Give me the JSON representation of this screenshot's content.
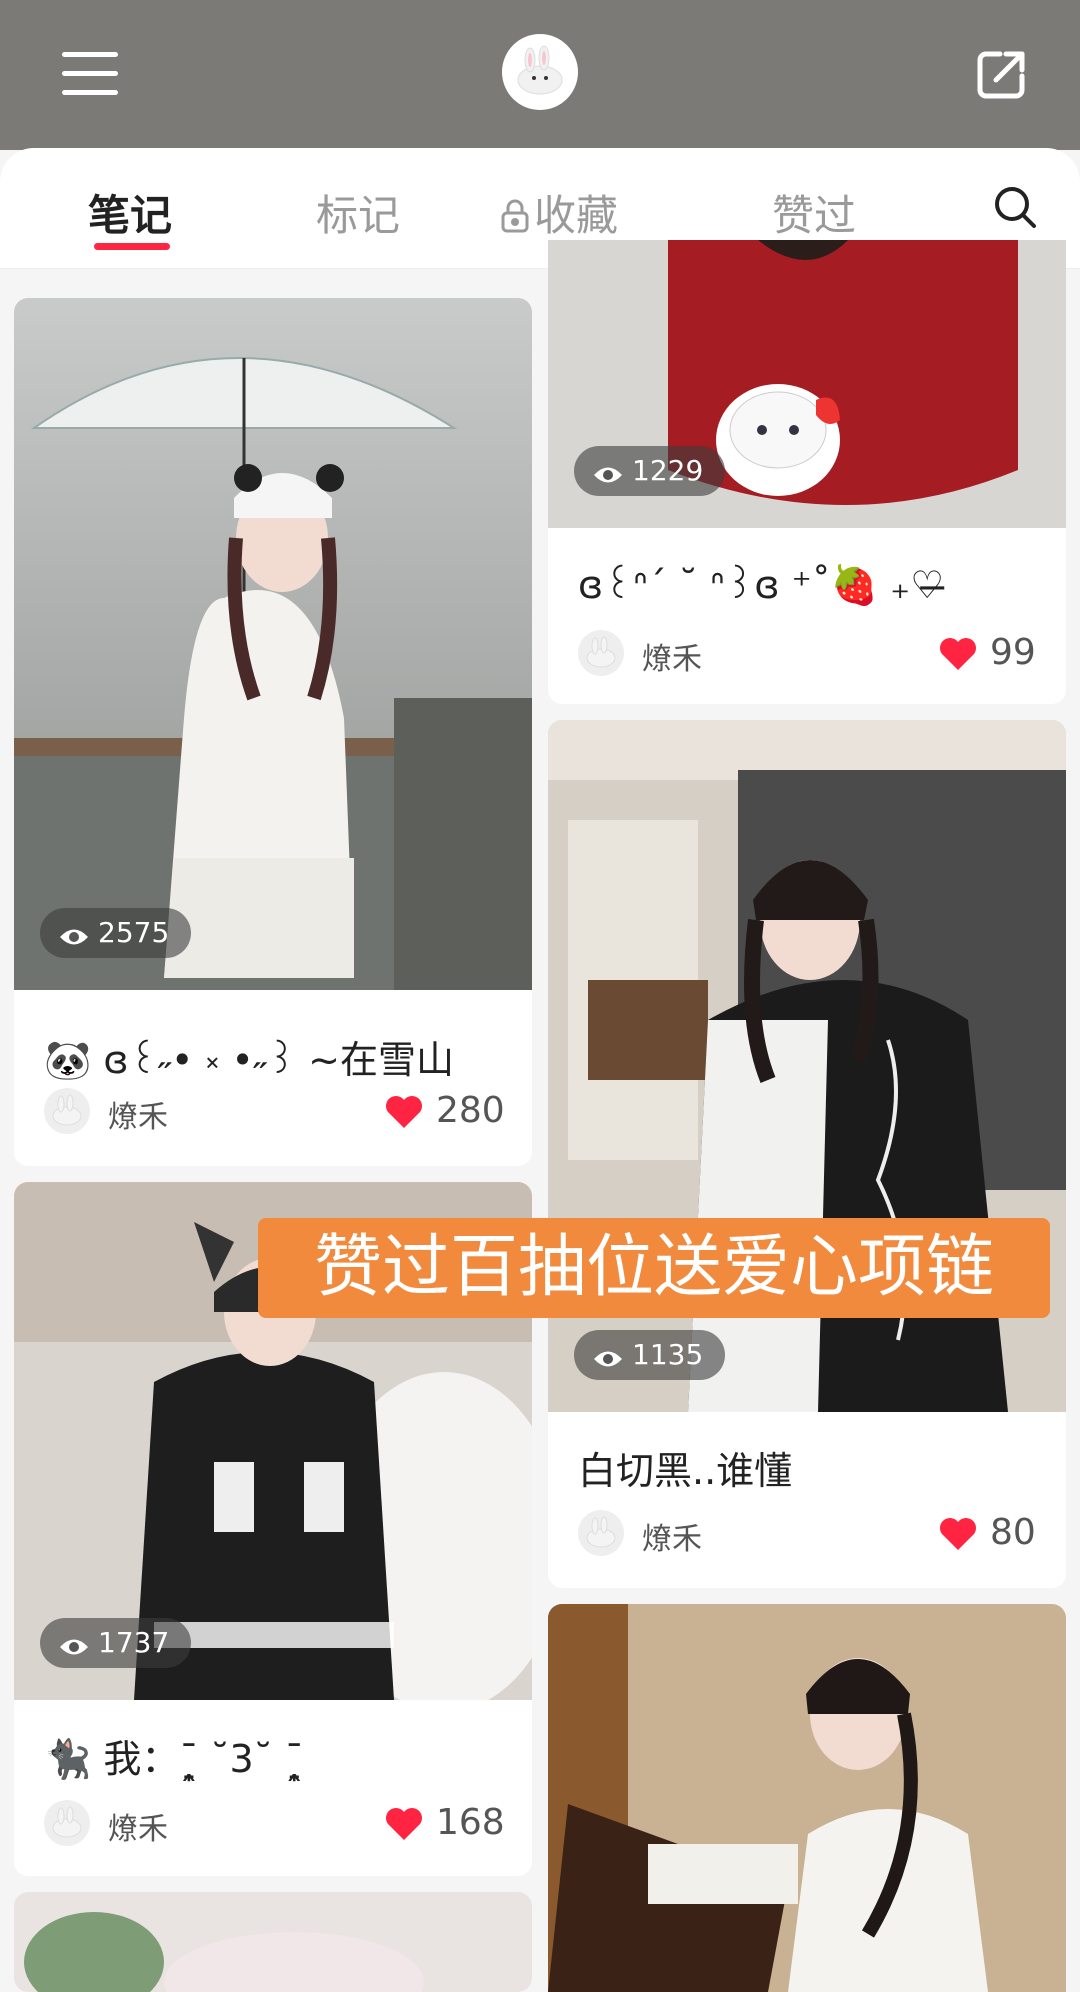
{
  "header": {
    "menu_icon": "hamburger-icon",
    "avatar_icon": "bunny-avatar",
    "share_icon": "share-export-icon"
  },
  "tabs": [
    {
      "label": "笔记",
      "active": true
    },
    {
      "label": "标记",
      "active": false
    },
    {
      "label": "收藏",
      "active": false,
      "icon": "lock-icon"
    },
    {
      "label": "赞过",
      "active": false
    }
  ],
  "search_icon": "search-icon",
  "accent_color": "#ff2442",
  "banner": {
    "text": "赞过百抽位送爱心项链",
    "color": "#f28a3d"
  },
  "cards": {
    "c1": {
      "views": "2575",
      "emoji": "🐼",
      "title": "ɞ꒰˶• ༝ •˶꒱ ~在雪山",
      "author": "燎禾",
      "likes": "280"
    },
    "c2": {
      "views": "1737",
      "emoji": "🐈‍⬛",
      "title": "我：ˉ̞̭ ˘3˘ ˉ̞̭",
      "author": "燎禾",
      "likes": "168"
    },
    "c3": {
      "views": "1229",
      "title": "ɞ꒰ᐢ´ ˘ ᐢ꒱ɞ ⁺˚🍓 ₊♡̶",
      "author": "燎禾",
      "likes": "99"
    },
    "c4": {
      "views": "1135",
      "title": "白切黑..谁懂",
      "author": "燎禾",
      "likes": "80"
    }
  }
}
